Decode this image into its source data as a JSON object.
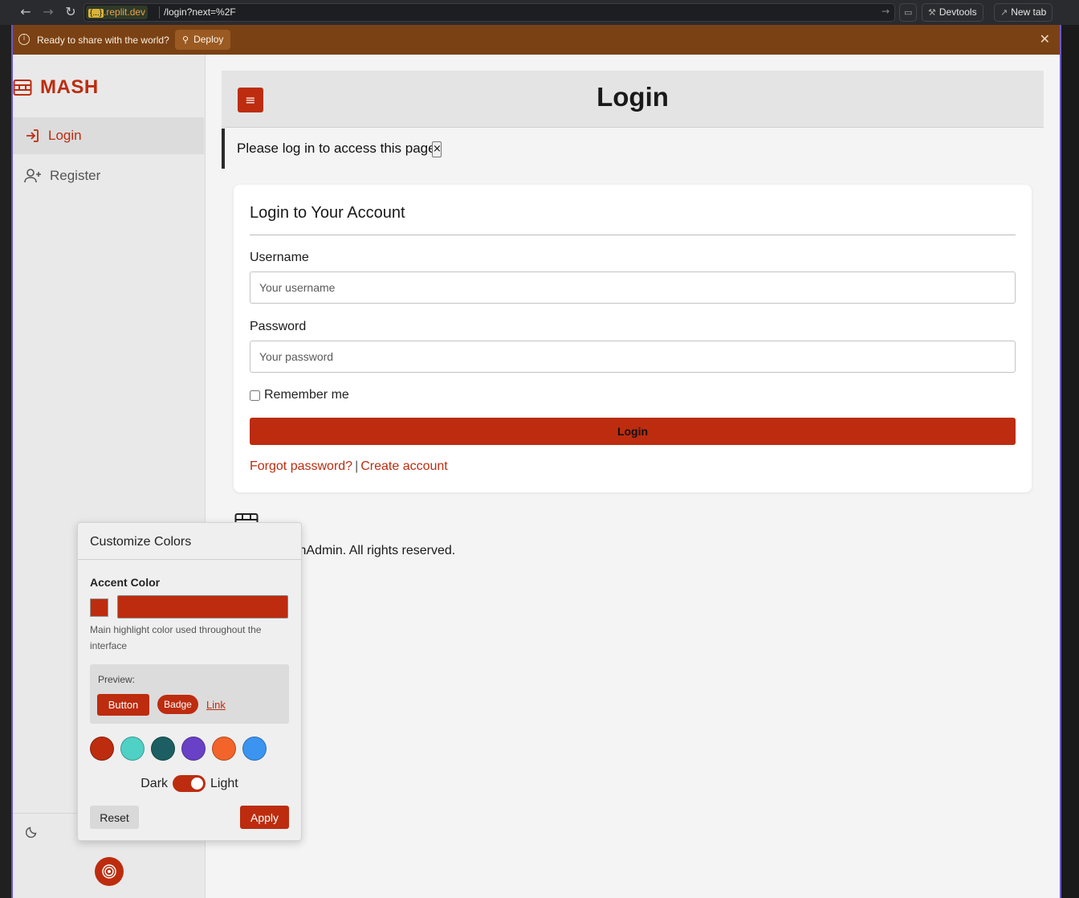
{
  "browser": {
    "host": ".replit.dev",
    "host_badge": "{...}",
    "url_path": "/login?next=%2F",
    "devtools_label": "Devtools",
    "new_tab_label": "New tab"
  },
  "deploy_banner": {
    "text": "Ready to share with the world?",
    "button_label": "Deploy"
  },
  "sidebar": {
    "logo_text": "MASH",
    "items": [
      {
        "label": "Login",
        "icon": "login-icon",
        "active": true
      },
      {
        "label": "Register",
        "icon": "user-plus-icon",
        "active": false
      }
    ]
  },
  "header": {
    "title": "Login"
  },
  "alert": {
    "text": "Please log in to access this page.",
    "close_label": "×"
  },
  "login_card": {
    "title": "Login to Your Account",
    "username_label": "Username",
    "username_placeholder": "Your username",
    "password_label": "Password",
    "password_placeholder": "Your password",
    "remember_label": "Remember me",
    "submit_label": "Login",
    "forgot_link": "Forgot password?",
    "separator": "|",
    "create_link": "Create account"
  },
  "footer": {
    "text": "© 2025 MashAdmin. All rights reserved."
  },
  "color_panel": {
    "title": "Customize Colors",
    "accent_label": "Accent Color",
    "accent_value": "#bd2c0f",
    "help_text": "Main highlight color used throughout the interface",
    "preview_label": "Preview:",
    "preview_button": "Button",
    "preview_badge": "Badge",
    "preview_link": "Link",
    "presets": [
      "#bd2c0f",
      "#4fd1c5",
      "#1d5e62",
      "#6941c6",
      "#f2642a",
      "#3b94f0"
    ],
    "theme_dark_label": "Dark",
    "theme_light_label": "Light",
    "theme_mode": "light",
    "reset_label": "Reset",
    "apply_label": "Apply"
  },
  "colors": {
    "accent": "#bd2c0f",
    "deploy_bar": "#7a4214",
    "frame": "#6b58c9"
  }
}
